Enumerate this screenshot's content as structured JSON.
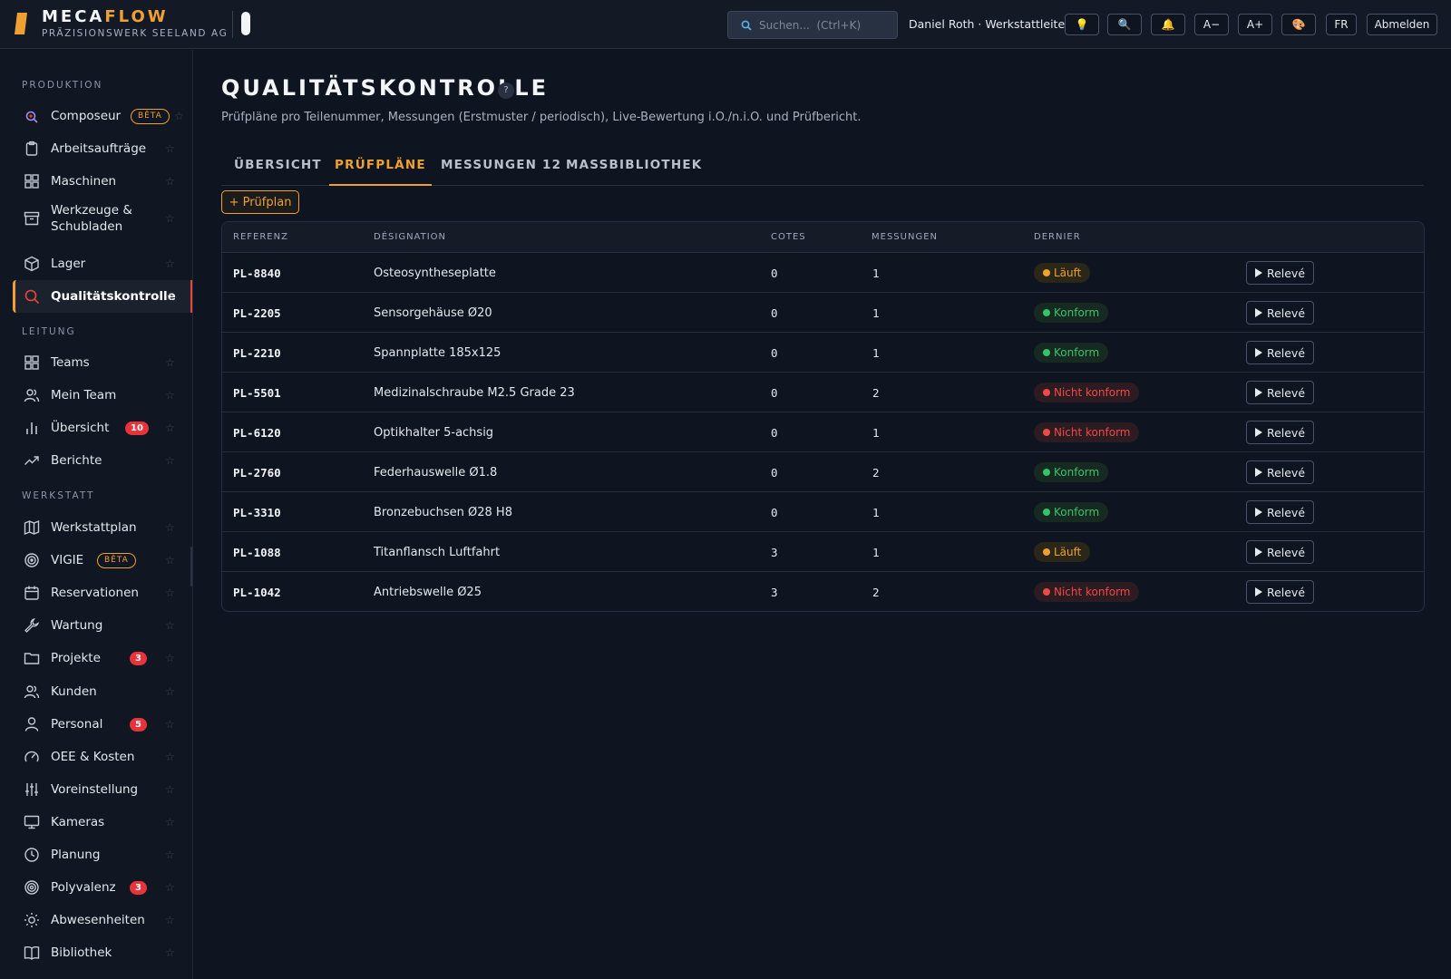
{
  "app": {
    "name_primary": "MECA",
    "name_accent": "FLOW",
    "company": "PRÄZISIONSWERK SEELAND AG",
    "brand_color": "#f0a030"
  },
  "topbar": {
    "search_placeholder": "Suchen...  (Ctrl+K)",
    "user": "Daniel Roth · Werkstattleiter",
    "buttons": [
      {
        "icon": "lightbulb-icon",
        "label": "💡"
      },
      {
        "icon": "search-icon",
        "label": "🔍"
      },
      {
        "icon": "bell-icon",
        "label": "🔔"
      },
      {
        "label": "A−"
      },
      {
        "label": "A+"
      },
      {
        "icon": "palette-icon",
        "label": "🎨"
      },
      {
        "label": "FR"
      },
      {
        "label": "Abmelden"
      }
    ]
  },
  "sidebar": {
    "sections": [
      {
        "title": "PRODUKTION",
        "items": [
          {
            "label": "Composeur",
            "icon": "wand-icon",
            "badge": "BÊTA"
          },
          {
            "label": "Arbeitsaufträge",
            "icon": "clipboard-icon"
          },
          {
            "label": "Maschinen",
            "icon": "grid-icon"
          },
          {
            "label": "Werkzeuge & Schubladen",
            "icon": "archive-icon"
          },
          {
            "label": "Lager",
            "icon": "box-icon"
          },
          {
            "label": "Qualitätskontrolle",
            "icon": "search-icon",
            "active": true
          }
        ]
      },
      {
        "title": "LEITUNG",
        "items": [
          {
            "label": "Teams",
            "icon": "grid-icon"
          },
          {
            "label": "Mein Team",
            "icon": "users-icon"
          },
          {
            "label": "Übersicht",
            "icon": "bar-chart-icon",
            "count": "10"
          },
          {
            "label": "Berichte",
            "icon": "trend-icon"
          }
        ]
      },
      {
        "title": "WERKSTATT",
        "items": [
          {
            "label": "Werkstattplan",
            "icon": "map-icon"
          },
          {
            "label": "VIGIE",
            "icon": "target-icon",
            "badge": "BÊTA"
          },
          {
            "label": "Reservationen",
            "icon": "calendar-icon"
          },
          {
            "label": "Wartung",
            "icon": "wrench-icon"
          },
          {
            "label": "Projekte",
            "icon": "folder-icon",
            "count": "3"
          },
          {
            "label": "Kunden",
            "icon": "users-icon"
          },
          {
            "label": "Personal",
            "icon": "person-icon",
            "count": "5"
          },
          {
            "label": "OEE & Kosten",
            "icon": "gauge-icon"
          },
          {
            "label": "Voreinstellung",
            "icon": "sliders-icon"
          },
          {
            "label": "Kameras",
            "icon": "monitor-icon"
          },
          {
            "label": "Planung",
            "icon": "clock-icon"
          },
          {
            "label": "Polyvalenz",
            "icon": "radar-icon",
            "count": "3"
          },
          {
            "label": "Abwesenheiten",
            "icon": "sun-icon"
          },
          {
            "label": "Bibliothek",
            "icon": "book-icon"
          }
        ]
      }
    ]
  },
  "page": {
    "title": "QUALITÄTSKONTROLLE",
    "help": "?",
    "subtitle": "Prüfpläne pro Teilenummer, Messungen (Erstmuster / periodisch), Live-Bewertung i.O./n.i.O. und Prüfbericht.",
    "tabs": [
      "ÜBERSICHT",
      "PRÜFPLÄNE",
      "MESSUNGEN 12",
      "MASSBIBLIOTHEK"
    ],
    "active_tab": "PRÜFPLÄNE",
    "add_button": "+ Prüfplan"
  },
  "table": {
    "headers": [
      "REFERENZ",
      "DÉSIGNATION",
      "COTES",
      "MESSUNGEN",
      "DERNIER"
    ],
    "action_label": "Relevé",
    "rows": [
      {
        "ref": "PL-8840",
        "designation": "Osteosyntheseplatte",
        "cotes": "0",
        "messungen": "1",
        "status": "Läuft",
        "kind": "run"
      },
      {
        "ref": "PL-2205",
        "designation": "Sensorgehäuse Ø20",
        "cotes": "0",
        "messungen": "1",
        "status": "Konform",
        "kind": "ok"
      },
      {
        "ref": "PL-2210",
        "designation": "Spannplatte 185x125",
        "cotes": "0",
        "messungen": "1",
        "status": "Konform",
        "kind": "ok"
      },
      {
        "ref": "PL-5501",
        "designation": "Medizinalschraube M2.5 Grade 23",
        "cotes": "0",
        "messungen": "2",
        "status": "Nicht konform",
        "kind": "nok"
      },
      {
        "ref": "PL-6120",
        "designation": "Optikhalter 5-achsig",
        "cotes": "0",
        "messungen": "1",
        "status": "Nicht konform",
        "kind": "nok"
      },
      {
        "ref": "PL-2760",
        "designation": "Federhauswelle Ø1.8",
        "cotes": "0",
        "messungen": "2",
        "status": "Konform",
        "kind": "ok"
      },
      {
        "ref": "PL-3310",
        "designation": "Bronzebuchsen Ø28 H8",
        "cotes": "0",
        "messungen": "1",
        "status": "Konform",
        "kind": "ok"
      },
      {
        "ref": "PL-1088",
        "designation": "Titanflansch Luftfahrt",
        "cotes": "3",
        "messungen": "1",
        "status": "Läuft",
        "kind": "run"
      },
      {
        "ref": "PL-1042",
        "designation": "Antriebswelle Ø25",
        "cotes": "3",
        "messungen": "2",
        "status": "Nicht konform",
        "kind": "nok"
      }
    ]
  }
}
